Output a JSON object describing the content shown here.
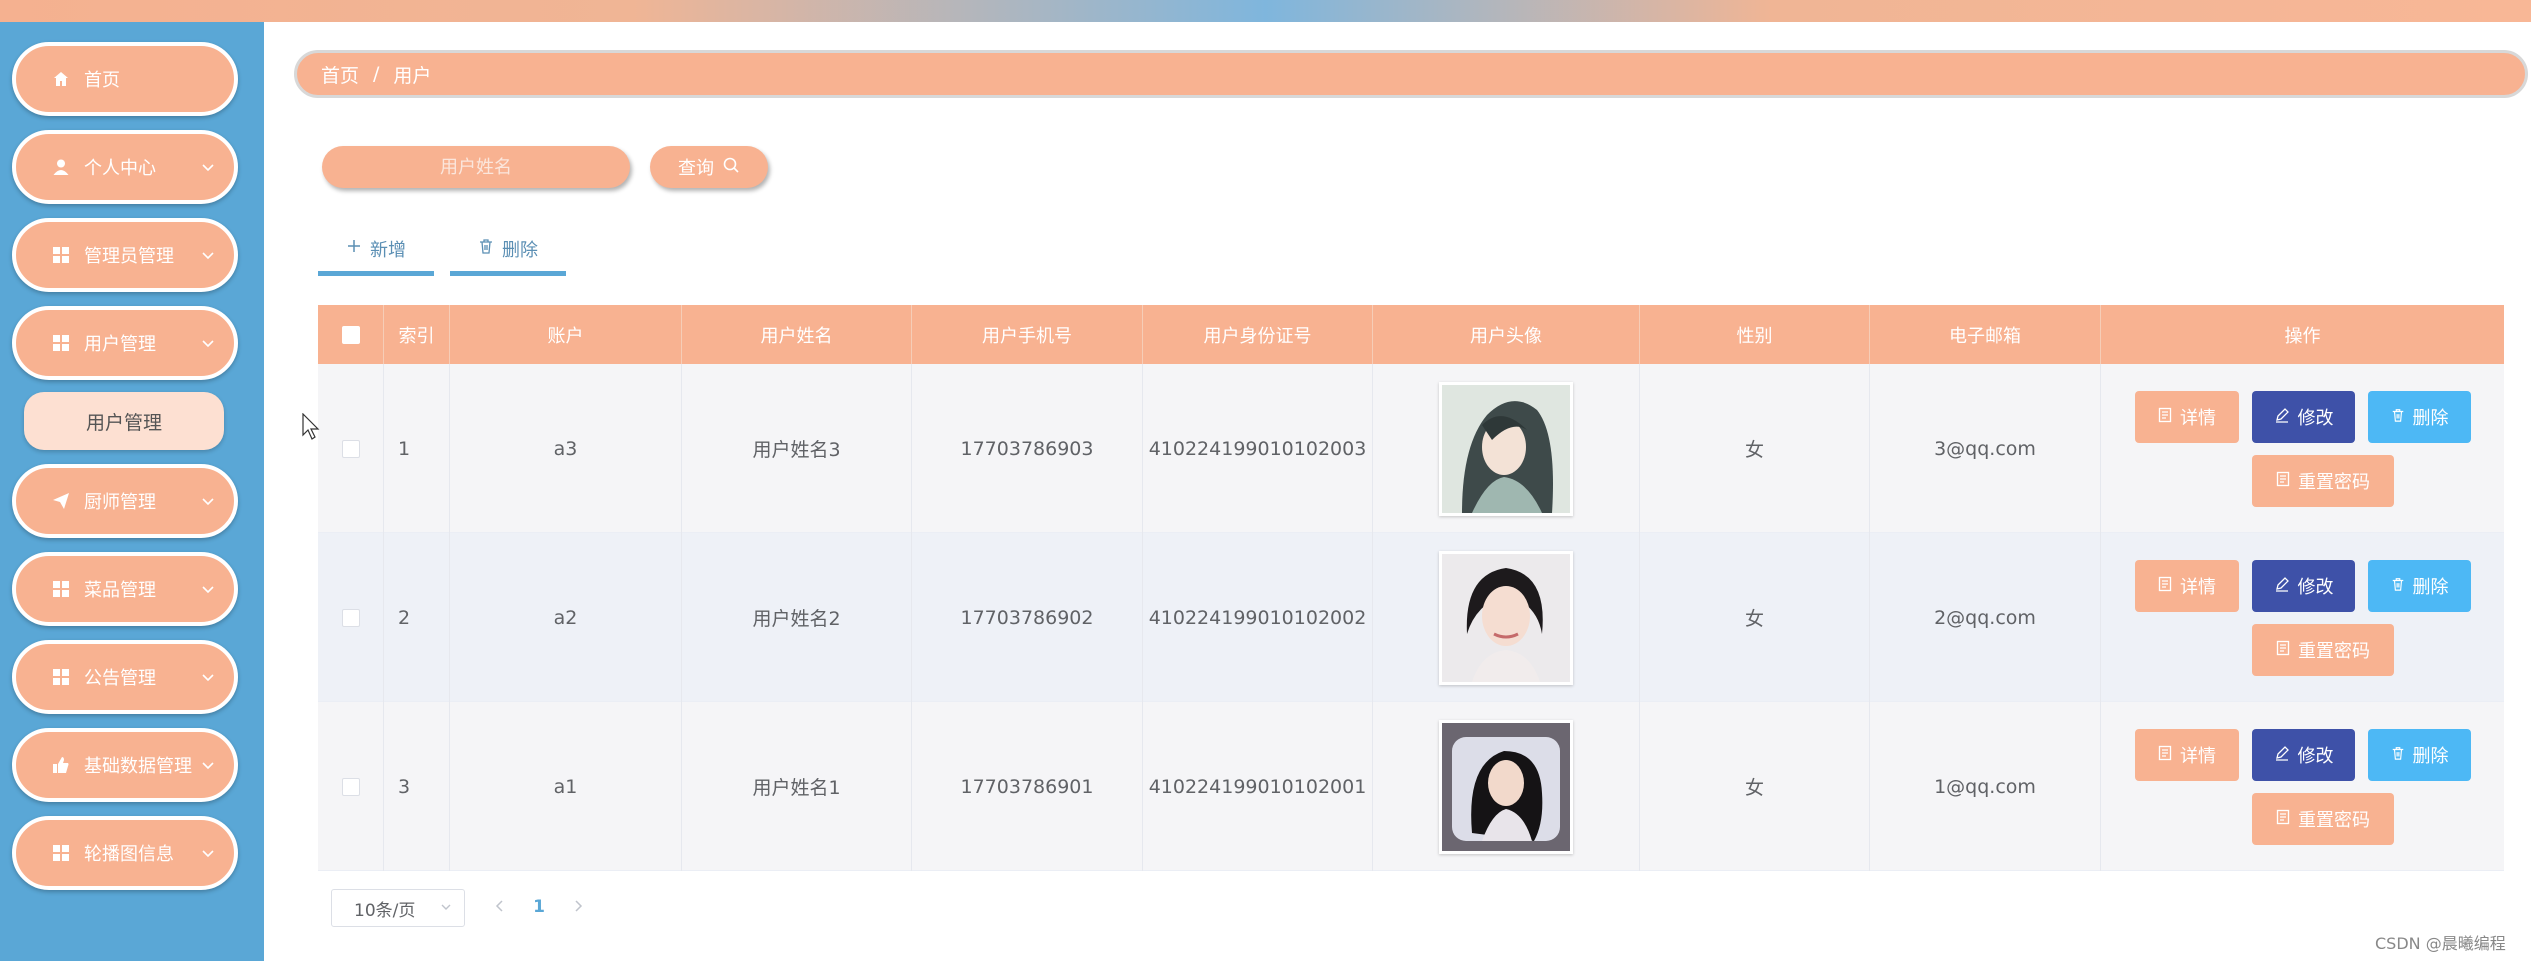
{
  "colors": {
    "sidebar_bg": "#5aa7d6",
    "accent_peach": "#f8b291",
    "edit_button": "#3e51a8",
    "delete_button": "#4db8f5",
    "link_blue": "#5b8fb4"
  },
  "sidebar": {
    "items": [
      {
        "label": "首页",
        "icon": "home-icon",
        "has_chevron": false
      },
      {
        "label": "个人中心",
        "icon": "user-icon",
        "has_chevron": true
      },
      {
        "label": "管理员管理",
        "icon": "grid-icon",
        "has_chevron": true
      },
      {
        "label": "用户管理",
        "icon": "grid-icon",
        "has_chevron": true
      },
      {
        "label": "厨师管理",
        "icon": "send-icon",
        "has_chevron": true
      },
      {
        "label": "菜品管理",
        "icon": "grid-icon",
        "has_chevron": true
      },
      {
        "label": "公告管理",
        "icon": "grid-icon",
        "has_chevron": true
      },
      {
        "label": "基础数据管理",
        "icon": "thumb-icon",
        "has_chevron": true
      },
      {
        "label": "轮播图信息",
        "icon": "grid-icon",
        "has_chevron": true
      }
    ],
    "submenu": {
      "label": "用户管理"
    }
  },
  "breadcrumb": {
    "home": "首页",
    "separator": "/",
    "current": "用户"
  },
  "search": {
    "placeholder": "用户姓名",
    "button_label": "查询"
  },
  "actions": {
    "add_label": "新增",
    "delete_label": "删除"
  },
  "table": {
    "headers": [
      "索引",
      "账户",
      "用户姓名",
      "用户手机号",
      "用户身份证号",
      "用户头像",
      "性别",
      "电子邮箱",
      "操作"
    ],
    "rows": [
      {
        "index": "1",
        "account": "a3",
        "name": "用户姓名3",
        "phone": "17703786903",
        "id_number": "410224199010102003",
        "avatar": "avatar-image-3",
        "gender": "女",
        "email": "3@qq.com"
      },
      {
        "index": "2",
        "account": "a2",
        "name": "用户姓名2",
        "phone": "17703786902",
        "id_number": "410224199010102002",
        "avatar": "avatar-image-2",
        "gender": "女",
        "email": "2@qq.com"
      },
      {
        "index": "3",
        "account": "a1",
        "name": "用户姓名1",
        "phone": "17703786901",
        "id_number": "410224199010102001",
        "avatar": "avatar-image-1",
        "gender": "女",
        "email": "1@qq.com"
      }
    ],
    "row_actions": {
      "detail": "详情",
      "edit": "修改",
      "delete": "删除",
      "reset_password": "重置密码"
    }
  },
  "pagination": {
    "page_size": "10条/页",
    "current_page": "1"
  },
  "watermark": "CSDN @晨曦编程"
}
